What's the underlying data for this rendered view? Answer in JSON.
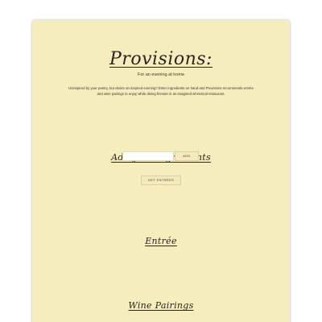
{
  "header": {
    "title": "Provisions:",
    "tagline": "For an evening at home",
    "description_line1": "Uninspired by your pantry, but desire an inspired evening? Enter ingredients on hand and Provisions recommends entrée",
    "description_line2": "and wine pairings to enjoy while dining fireside in an imagined whimsical restaurant."
  },
  "ingredients": {
    "heading": "Add your ingredients",
    "input_value": "",
    "input_placeholder": "",
    "add_label": "ADD"
  },
  "entree_button_label": "GET ENTRÉES",
  "sections": {
    "entree_heading": "Entrée",
    "pairings_heading": "Wine Pairings"
  },
  "colors": {
    "card_background": "#f6edbe",
    "text": "#2a2520"
  }
}
